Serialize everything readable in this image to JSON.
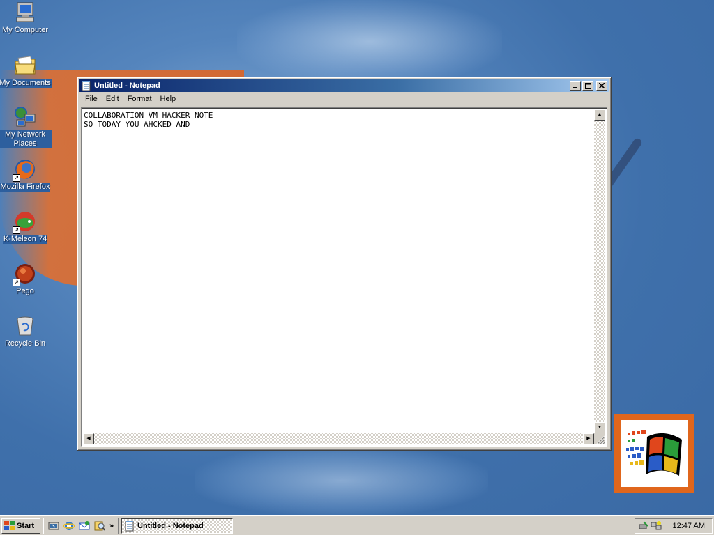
{
  "desktop": {
    "icons": [
      {
        "label": "My Computer",
        "icon": "computer-icon"
      },
      {
        "label": "My Documents",
        "icon": "folder-icon"
      },
      {
        "label": "My Network Places",
        "icon": "network-icon"
      },
      {
        "label": "Mozilla Firefox",
        "icon": "firefox-icon"
      },
      {
        "label": "K-Meleon 74",
        "icon": "k-meleon-icon"
      },
      {
        "label": "Pego",
        "icon": "pego-icon"
      },
      {
        "label": "Recycle Bin",
        "icon": "recycle-bin-icon"
      }
    ]
  },
  "notepad": {
    "title": "Untitled - Notepad",
    "menu": [
      "File",
      "Edit",
      "Format",
      "Help"
    ],
    "text_lines": [
      "COLLABORATION VM HACKER NOTE",
      "SO TODAY YOU AHCKED AND "
    ]
  },
  "taskbar": {
    "start_label": "Start",
    "quick_launch": [
      "show-desktop-icon",
      "internet-explorer-icon",
      "outlook-express-icon",
      "search-icon"
    ],
    "more_label": "»",
    "tasks": [
      {
        "label": "Untitled - Notepad",
        "icon": "notepad-icon"
      }
    ],
    "clock": "12:47 AM"
  },
  "colors": {
    "desktop_bg": "#3a6ea5",
    "titlebar_start": "#0a246a",
    "titlebar_end": "#a6caf0",
    "accent_orange": "#e0661c"
  }
}
